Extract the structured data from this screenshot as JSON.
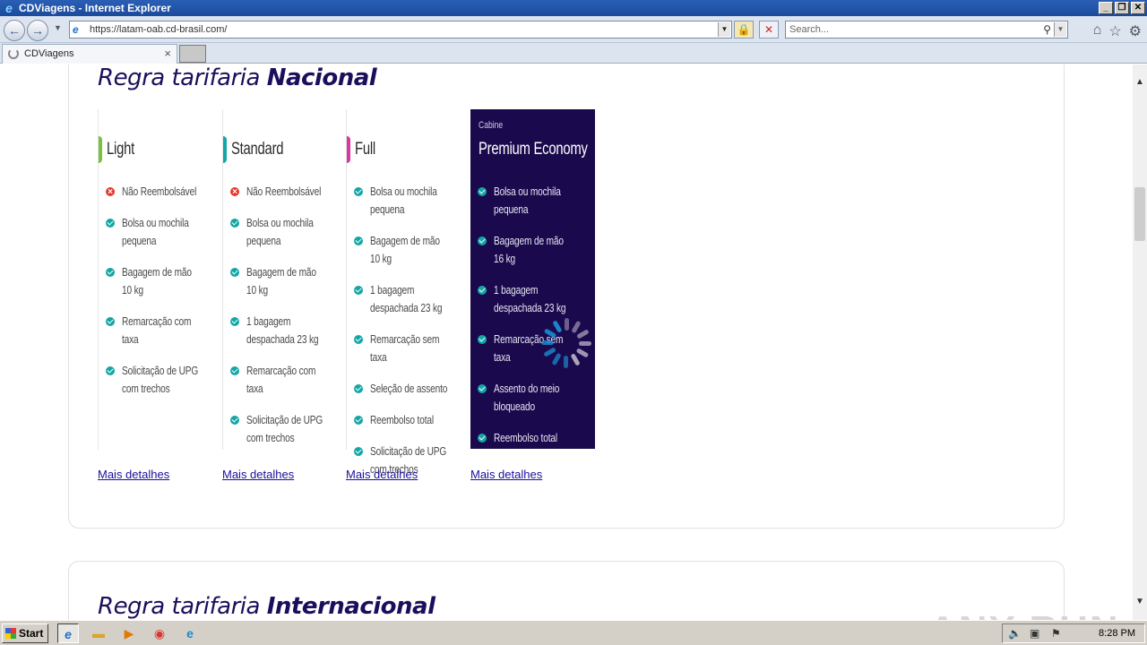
{
  "window": {
    "title": "CDViagens - Internet Explorer"
  },
  "browser": {
    "url": "https://latam-oab.cd-brasil.com/",
    "search_placeholder": "Search...",
    "tab_title": "CDViagens"
  },
  "page": {
    "section1": {
      "prefix": "Regra tarifaria ",
      "emph": "Nacional"
    },
    "section2": {
      "prefix": "Regra tarifaria ",
      "emph": "Internacional"
    },
    "fares": [
      {
        "name": "Light",
        "color": "#7ac143",
        "items": [
          {
            "icon": "no",
            "text": "Não Reembolsável"
          },
          {
            "icon": "ok",
            "text": "Bolsa ou mochila pequena"
          },
          {
            "icon": "ok",
            "text": "Bagagem de mão 10 kg"
          },
          {
            "icon": "ok",
            "text": "Remarcação com taxa"
          },
          {
            "icon": "ok",
            "text": "Solicitação de UPG com trechos"
          }
        ],
        "link": "Mais detalhes"
      },
      {
        "name": "Standard",
        "color": "#14a6a6",
        "items": [
          {
            "icon": "no",
            "text": "Não Reembolsável"
          },
          {
            "icon": "ok",
            "text": "Bolsa ou mochila pequena"
          },
          {
            "icon": "ok",
            "text": "Bagagem de mão 10 kg"
          },
          {
            "icon": "ok",
            "text": "1 bagagem despachada 23 kg"
          },
          {
            "icon": "ok",
            "text": "Remarcação com taxa"
          },
          {
            "icon": "ok",
            "text": "Solicitação de UPG com trechos"
          }
        ],
        "link": "Mais detalhes"
      },
      {
        "name": "Full",
        "color": "#d63aa0",
        "items": [
          {
            "icon": "ok",
            "text": "Bolsa ou mochila pequena"
          },
          {
            "icon": "ok",
            "text": "Bagagem de mão 10 kg"
          },
          {
            "icon": "ok",
            "text": "1 bagagem despachada 23 kg"
          },
          {
            "icon": "ok",
            "text": "Remarcação sem taxa"
          },
          {
            "icon": "ok",
            "text": "Seleção de assento"
          },
          {
            "icon": "ok",
            "text": "Reembolso total"
          },
          {
            "icon": "ok",
            "text": "Solicitação de UPG com trechos"
          }
        ],
        "link": "Mais detalhes"
      },
      {
        "name": "Premium Economy",
        "cabin_label": "Cabine",
        "color": "#1a0a4d",
        "items": [
          {
            "icon": "ok",
            "text": "Bolsa ou mochila pequena"
          },
          {
            "icon": "ok",
            "text": "Bagagem de mão 16 kg"
          },
          {
            "icon": "ok",
            "text": "1 bagagem despachada 23 kg"
          },
          {
            "icon": "ok",
            "text": "Remarcação sem taxa"
          },
          {
            "icon": "ok",
            "text": "Assento do meio bloqueado"
          },
          {
            "icon": "ok",
            "text": "Reembolso total"
          }
        ],
        "link": "Mais detalhes"
      }
    ]
  },
  "watermark": "ANY RUN",
  "taskbar": {
    "start_label": "Start",
    "time": "8:28 PM"
  }
}
